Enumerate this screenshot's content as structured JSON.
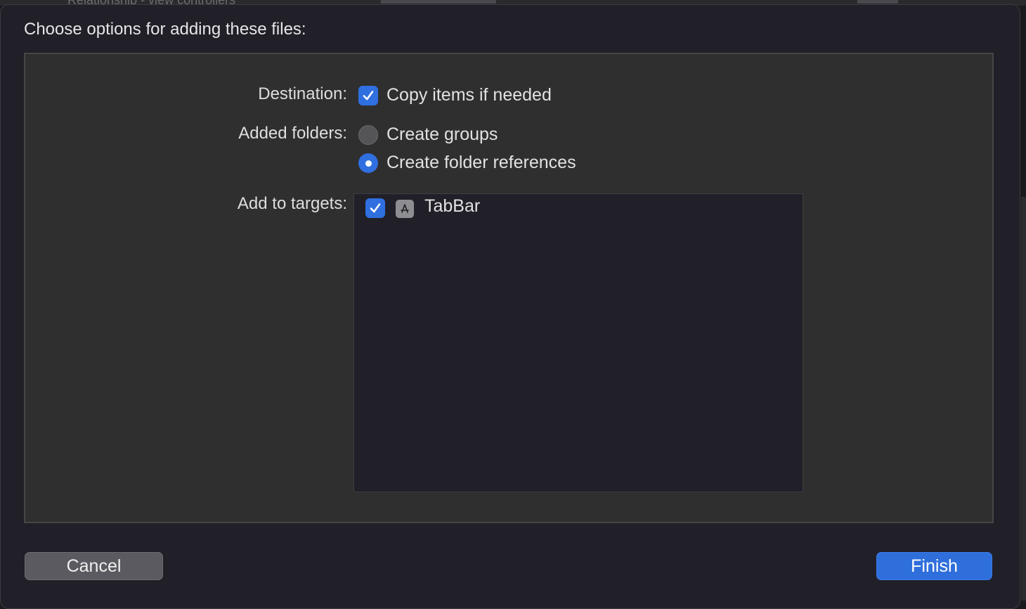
{
  "background_window": {
    "ghost_text": "Relationship - view controllers"
  },
  "dialog": {
    "title": "Choose options for adding these files:",
    "destination": {
      "label": "Destination:",
      "checkbox_label": "Copy items if needed",
      "checked": true
    },
    "added_folders": {
      "label": "Added folders:",
      "options": [
        {
          "label": "Create groups",
          "selected": false
        },
        {
          "label": "Create folder references",
          "selected": true
        }
      ]
    },
    "targets": {
      "label": "Add to targets:",
      "items": [
        {
          "name": "TabBar",
          "checked": true,
          "icon": "app-target-icon"
        }
      ]
    },
    "buttons": {
      "cancel": "Cancel",
      "finish": "Finish"
    }
  },
  "colors": {
    "accent": "#2f6fe0",
    "sheet_bg": "#211f27",
    "panel_bg": "#2f2f2f"
  }
}
